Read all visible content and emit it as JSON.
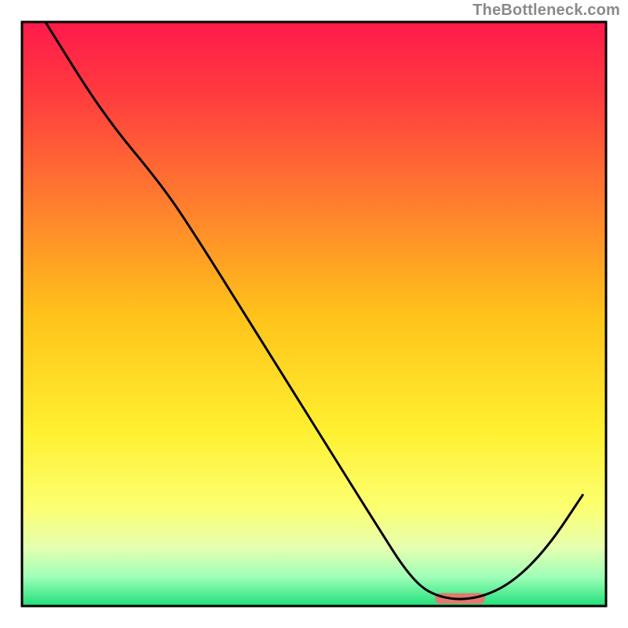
{
  "watermark": "TheBottleneck.com",
  "chart_data": {
    "type": "line",
    "title": "",
    "xlabel": "",
    "ylabel": "",
    "xlim": [
      0,
      100
    ],
    "ylim": [
      0,
      100
    ],
    "grid": false,
    "background_gradient": {
      "stops": [
        {
          "offset": 0.0,
          "color": "#ff1a4b"
        },
        {
          "offset": 0.12,
          "color": "#ff3a3f"
        },
        {
          "offset": 0.3,
          "color": "#ff7a2f"
        },
        {
          "offset": 0.5,
          "color": "#ffc21a"
        },
        {
          "offset": 0.7,
          "color": "#fff030"
        },
        {
          "offset": 0.83,
          "color": "#fcff70"
        },
        {
          "offset": 0.9,
          "color": "#e6ffb0"
        },
        {
          "offset": 0.95,
          "color": "#9fffb8"
        },
        {
          "offset": 1.0,
          "color": "#1fe07a"
        }
      ]
    },
    "curve_points": [
      {
        "x": 4.0,
        "y": 100.0
      },
      {
        "x": 14.0,
        "y": 84.0
      },
      {
        "x": 24.0,
        "y": 72.0
      },
      {
        "x": 30.0,
        "y": 63.0
      },
      {
        "x": 40.0,
        "y": 47.0
      },
      {
        "x": 50.0,
        "y": 31.0
      },
      {
        "x": 60.0,
        "y": 15.0
      },
      {
        "x": 67.0,
        "y": 4.0
      },
      {
        "x": 72.0,
        "y": 1.2
      },
      {
        "x": 78.0,
        "y": 1.2
      },
      {
        "x": 84.0,
        "y": 4.0
      },
      {
        "x": 90.0,
        "y": 10.0
      },
      {
        "x": 96.0,
        "y": 19.0
      }
    ],
    "marker": {
      "x_center": 75.0,
      "y": 1.3,
      "width": 8.5,
      "height": 1.8,
      "color": "#e2786f"
    },
    "plot_border_inset_px": 28
  }
}
